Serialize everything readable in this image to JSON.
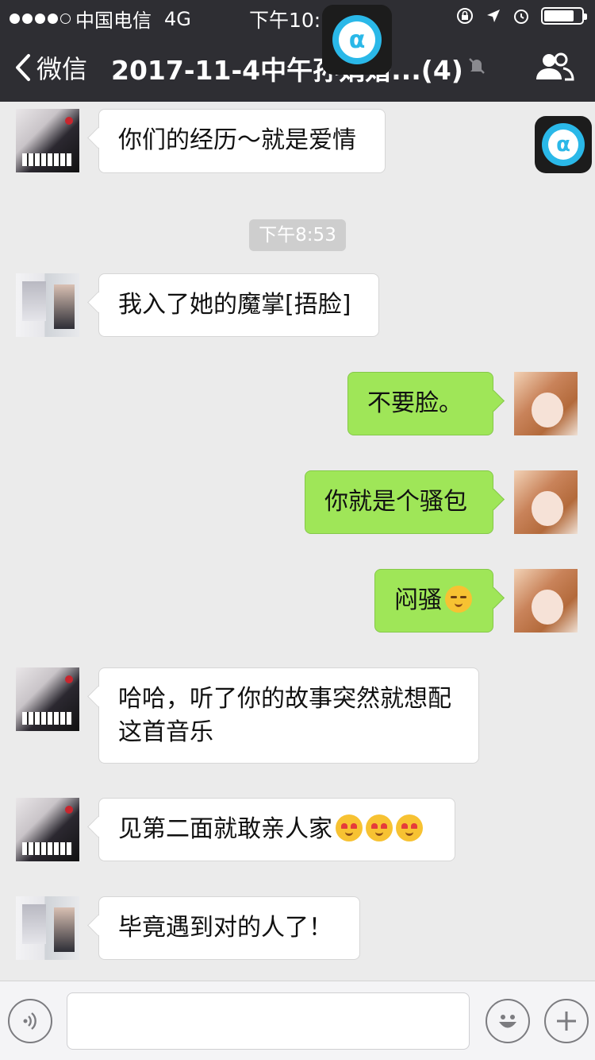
{
  "status_bar": {
    "carrier": "中国电信",
    "network": "4G",
    "time": "下午10:18",
    "signal_bars_filled": 4,
    "signal_bars_total": 5,
    "battery_level": 0.8
  },
  "nav": {
    "back_label": "微信",
    "title": "2017-11-4中午孙娟婚...(4)",
    "icons": [
      "chevron-left-icon",
      "mute-icon",
      "group-members-icon"
    ]
  },
  "floating_app": {
    "symbol": "α",
    "colors": {
      "ring": "#2ab8e8",
      "bg": "#1c1c1c"
    }
  },
  "messages": [
    {
      "side": "left",
      "avatar": "piano",
      "text": "你们的经历～就是爱情"
    },
    {
      "side": "left",
      "avatar": "wedding",
      "text": "我入了她的魔掌[捂脸]"
    },
    {
      "side": "right",
      "avatar": "girl",
      "text": "不要脸。"
    },
    {
      "side": "right",
      "avatar": "girl",
      "text": "你就是个骚包"
    },
    {
      "side": "right",
      "avatar": "girl",
      "text": "闷骚",
      "emoji": "smirk-emoji"
    },
    {
      "side": "left",
      "avatar": "piano",
      "text": "哈哈，听了你的故事突然就想配这首音乐"
    },
    {
      "side": "left",
      "avatar": "piano",
      "text": "见第二面就敢亲人家",
      "emoji": "heart-eyes-emoji"
    },
    {
      "side": "left",
      "avatar": "wedding",
      "text": "毕竟遇到对的人了！"
    }
  ],
  "timestamp": "下午8:53",
  "input_bar": {
    "icons": [
      "voice-icon",
      "emoji-icon",
      "plus-icon"
    ]
  },
  "colors": {
    "nav_bg": "#2e2e33",
    "chat_bg": "#ebebeb",
    "outgoing_bubble": "#9fe658",
    "incoming_bubble": "#ffffff"
  }
}
